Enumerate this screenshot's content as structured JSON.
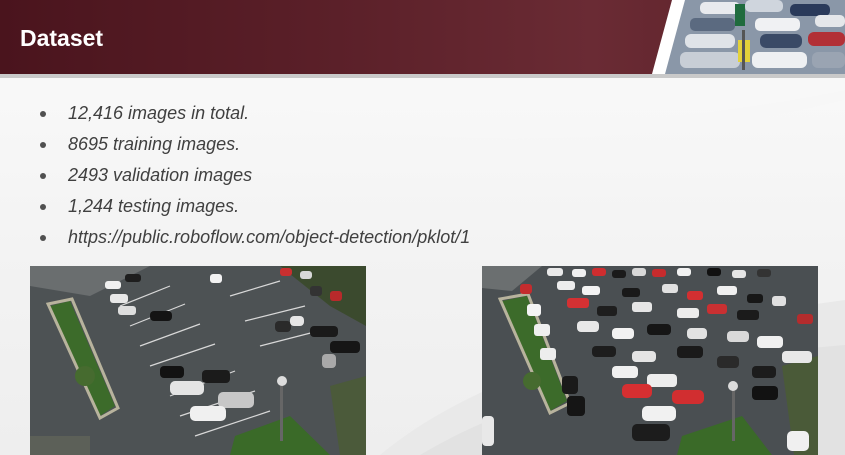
{
  "title": "Dataset",
  "bullets": [
    "12,416 images in total.",
    "8695 training images.",
    "2493 validation images",
    "1,244 testing images.",
    "https://public.roboflow.com/object-detection/pklot/1"
  ],
  "colors": {
    "header_bg": "#5b2029",
    "title_text": "#ffffff",
    "body_text": "#404040"
  },
  "images": [
    {
      "name": "parking-lot-photo-sparse"
    },
    {
      "name": "parking-lot-photo-full"
    }
  ]
}
